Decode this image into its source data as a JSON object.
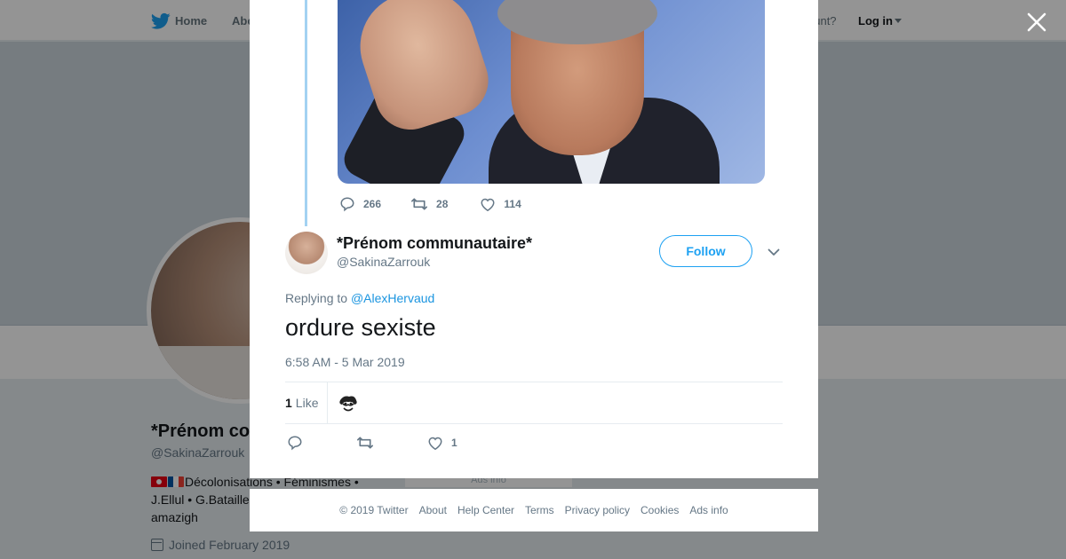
{
  "nav": {
    "home": "Home",
    "about": "Abo",
    "account_prompt": "ccount?",
    "login": "Log in"
  },
  "profile_bg": {
    "name": "*Prénom co",
    "handle": "@SakinaZarrouk",
    "bio_line1": "Décolonisations • Féminismes •",
    "bio_line2": "J.Ellul • G.Bataille",
    "bio_line3": "amazigh",
    "joined": "Joined February 2019",
    "stub": "Ads info"
  },
  "parent_tweet": {
    "replies": "266",
    "retweets": "28",
    "likes": "114"
  },
  "tweet": {
    "author_name": "*Prénom communautaire*",
    "author_handle": "@SakinaZarrouk",
    "follow_label": "Follow",
    "replying_prefix": "Replying to",
    "replying_to": "@AlexHervaud",
    "text": "ordure sexiste",
    "timestamp": "6:58 AM - 5 Mar 2019",
    "like_count": "1",
    "like_label": "Like",
    "action_likes": "1"
  },
  "footer": {
    "copyright": "© 2019 Twitter",
    "about": "About",
    "help": "Help Center",
    "terms": "Terms",
    "privacy": "Privacy policy",
    "cookies": "Cookies",
    "ads": "Ads info"
  },
  "colors": {
    "accent": "#1da1f2",
    "link": "#1b95e0",
    "thread_line": "#a3d2f2",
    "muted": "#657786"
  }
}
